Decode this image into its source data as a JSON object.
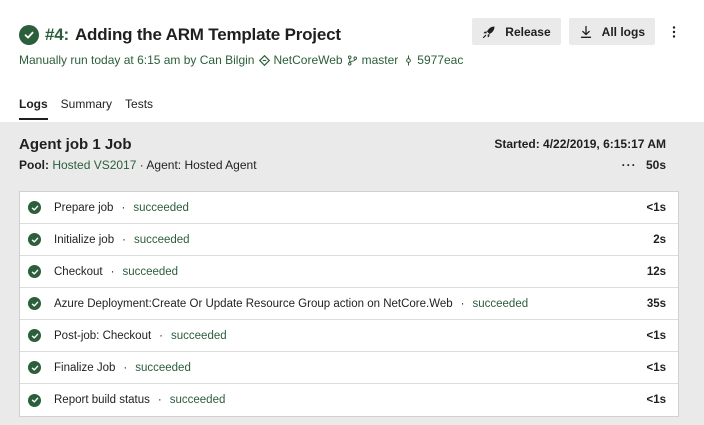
{
  "header": {
    "run_number": "#4:",
    "title": "Adding the ARM Template Project",
    "trigger_text": "Manually run today at 6:15 am by Can Bilgin",
    "repo": "NetCoreWeb",
    "branch": "master",
    "commit": "5977eac"
  },
  "actions": {
    "release_label": "Release",
    "all_logs_label": "All logs"
  },
  "tabs": [
    {
      "label": "Logs",
      "active": true
    },
    {
      "label": "Summary",
      "active": false
    },
    {
      "label": "Tests",
      "active": false
    }
  ],
  "job": {
    "title": "Agent job 1 Job",
    "started": "Started: 4/22/2019, 6:15:17 AM",
    "pool_label": "Pool:",
    "pool_value": "Hosted VS2017",
    "agent_label": "· Agent:",
    "agent_value": "Hosted Agent",
    "duration_dots": "···",
    "duration": "50s"
  },
  "steps": [
    {
      "name": "Prepare job",
      "status": "succeeded",
      "time": "<1s"
    },
    {
      "name": "Initialize job",
      "status": "succeeded",
      "time": "2s"
    },
    {
      "name": "Checkout",
      "status": "succeeded",
      "time": "12s"
    },
    {
      "name": "Azure Deployment:Create Or Update Resource Group action on NetCore.Web",
      "status": "succeeded",
      "time": "35s"
    },
    {
      "name": "Post-job: Checkout",
      "status": "succeeded",
      "time": "<1s"
    },
    {
      "name": "Finalize Job",
      "status": "succeeded",
      "time": "<1s"
    },
    {
      "name": "Report build status",
      "status": "succeeded",
      "time": "<1s"
    }
  ],
  "colors": {
    "success": "#2b5e3a",
    "panel_bg": "#eaeaea",
    "button_bg": "#eaeaea"
  },
  "icons": {
    "status": "check-circle-icon",
    "repo": "repo-diamond-icon",
    "branch": "branch-icon",
    "commit": "commit-icon",
    "release": "rocket-icon",
    "all_logs": "download-icon",
    "more": "more-vertical-icon"
  }
}
